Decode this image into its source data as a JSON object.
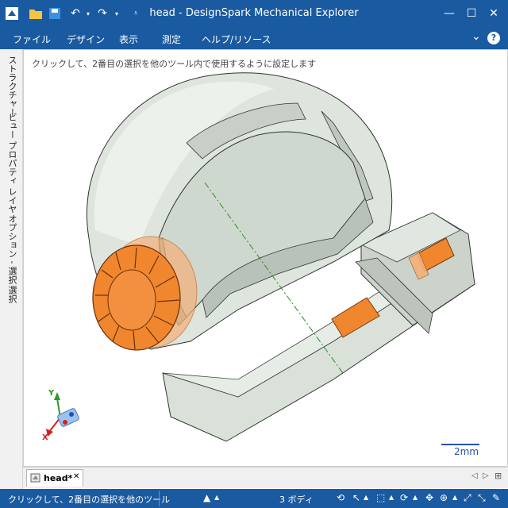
{
  "window": {
    "title": "head - DesignSpark Mechanical Explorer",
    "minimize": "—",
    "maximize": "☐",
    "close": "✕"
  },
  "menu": [
    "ファイル",
    "デザイン",
    "表示",
    "測定",
    "ヘルプ/リソース"
  ],
  "menu_right": {
    "collapse": "⌄",
    "help": "?"
  },
  "side_tabs": [
    "ストラクチャー",
    "ビュー",
    "プロパティ",
    "レイヤ",
    "オプション - 選択",
    "選択"
  ],
  "hint": "クリックして、2番目の選択を他のツール内で使用するように設定します",
  "axis_labels": {
    "y": "Y",
    "x": "X"
  },
  "scale": "2mm",
  "doc_tab": {
    "label": "head*",
    "close": "✕"
  },
  "status": {
    "message": "クリックして、2番目の選択を他のツール",
    "bodies": "3 ボディ"
  },
  "colors": {
    "accent": "#1a5aa0",
    "body": "#dfe6df",
    "orange": "#f0872e"
  }
}
